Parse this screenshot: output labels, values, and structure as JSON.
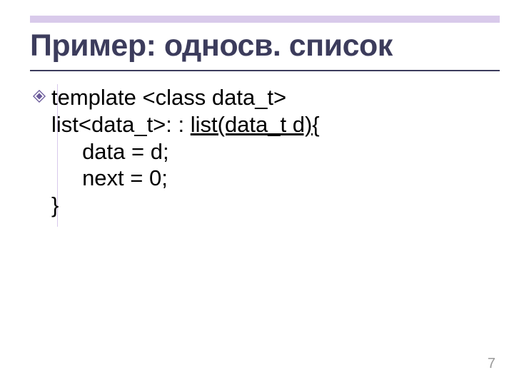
{
  "title": "Пример: односв. список",
  "code": {
    "line1": "template <class data_t>",
    "line2_pre": "list<data_t>: : ",
    "line2_call": "list(data_t d){",
    "line3": "     data = d;",
    "line4": "     next = 0;",
    "line5": "}"
  },
  "page_number": "7"
}
